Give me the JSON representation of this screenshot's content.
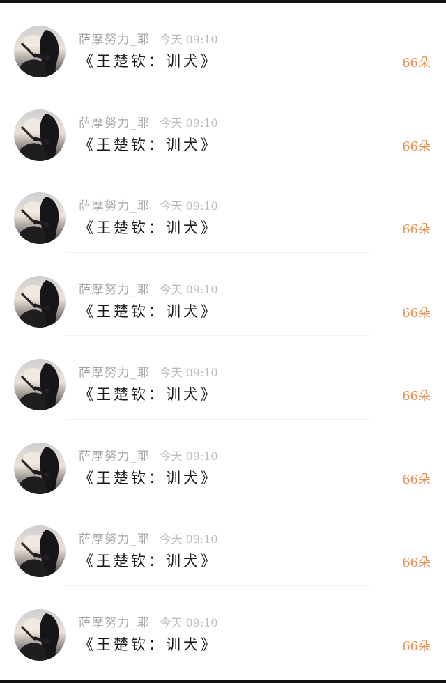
{
  "colors": {
    "username": "#a5a5a5",
    "time": "#b9b9b9",
    "title": "#1b1b1b",
    "flower_count": "#e78e55",
    "divider": "#f1f1f1",
    "background": "#ffffff"
  },
  "items": [
    {
      "username": "萨摩努力_耶",
      "time": "今天 09:10",
      "title": "《王楚钦：训犬》",
      "flowers": "66朵",
      "avatar_icon": "user-avatar-icon"
    },
    {
      "username": "萨摩努力_耶",
      "time": "今天 09:10",
      "title": "《王楚钦：训犬》",
      "flowers": "66朵",
      "avatar_icon": "user-avatar-icon"
    },
    {
      "username": "萨摩努力_耶",
      "time": "今天 09:10",
      "title": "《王楚钦：训犬》",
      "flowers": "66朵",
      "avatar_icon": "user-avatar-icon"
    },
    {
      "username": "萨摩努力_耶",
      "time": "今天 09:10",
      "title": "《王楚钦：训犬》",
      "flowers": "66朵",
      "avatar_icon": "user-avatar-icon"
    },
    {
      "username": "萨摩努力_耶",
      "time": "今天 09:10",
      "title": "《王楚钦：训犬》",
      "flowers": "66朵",
      "avatar_icon": "user-avatar-icon"
    },
    {
      "username": "萨摩努力_耶",
      "time": "今天 09:10",
      "title": "《王楚钦：训犬》",
      "flowers": "66朵",
      "avatar_icon": "user-avatar-icon"
    },
    {
      "username": "萨摩努力_耶",
      "time": "今天 09:10",
      "title": "《王楚钦：训犬》",
      "flowers": "66朵",
      "avatar_icon": "user-avatar-icon"
    },
    {
      "username": "萨摩努力_耶",
      "time": "今天 09:10",
      "title": "《王楚钦：训犬》",
      "flowers": "66朵",
      "avatar_icon": "user-avatar-icon"
    }
  ]
}
